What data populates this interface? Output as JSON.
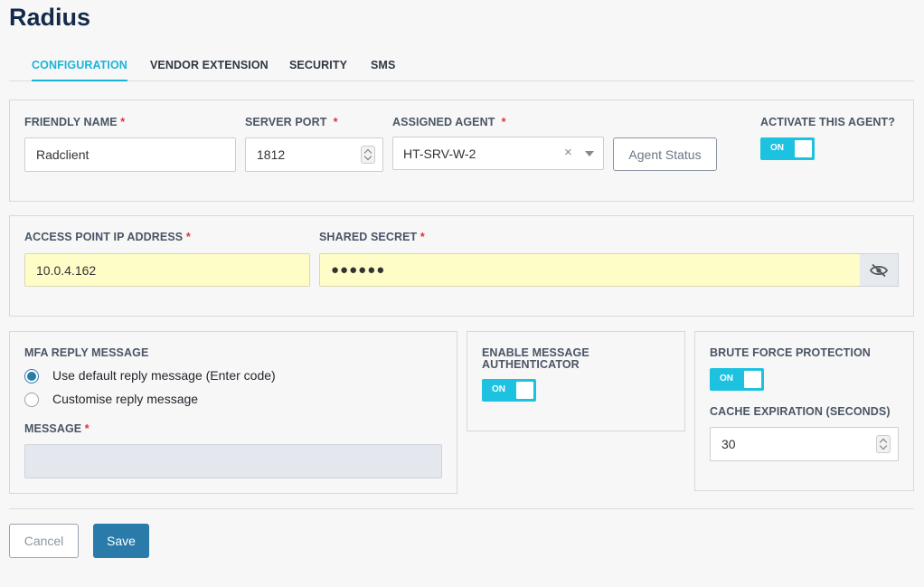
{
  "page": {
    "title": "Radius"
  },
  "tabs": [
    {
      "label": "CONFIGURATION"
    },
    {
      "label": "VENDOR EXTENSION"
    },
    {
      "label": "SECURITY"
    },
    {
      "label": "SMS"
    }
  ],
  "agent_section": {
    "friendly_name_label": "FRIENDLY NAME",
    "friendly_name_value": "Radclient",
    "server_port_label": "SERVER PORT",
    "server_port_value": "1812",
    "assigned_agent_label": "ASSIGNED AGENT",
    "assigned_agent_value": "HT-SRV-W-2",
    "agent_status_button": "Agent Status",
    "activate_label": "ACTIVATE THIS AGENT?",
    "activate_toggle": "ON"
  },
  "access_section": {
    "ip_label": "ACCESS POINT IP ADDRESS",
    "ip_value": "10.0.4.162",
    "secret_label": "SHARED SECRET",
    "secret_value": "●●●●●●"
  },
  "mfa_section": {
    "title": "MFA REPLY MESSAGE",
    "option_default": "Use default reply message (Enter code)",
    "option_custom": "Customise reply message",
    "message_label": "MESSAGE",
    "message_value": ""
  },
  "authenticator_section": {
    "title_line1": "ENABLE MESSAGE",
    "title_line2": "AUTHENTICATOR",
    "toggle": "ON"
  },
  "brute_force_section": {
    "title": "BRUTE FORCE PROTECTION",
    "toggle": "ON",
    "cache_label": "CACHE EXPIRATION (SECONDS)",
    "cache_value": "30"
  },
  "required_marker": "*",
  "clear_glyph": "×",
  "footer": {
    "cancel": "Cancel",
    "save": "Save"
  },
  "colors": {
    "accent": "#19b5d8",
    "toggle": "#1cc2e0",
    "primary": "#2a7aaa",
    "highlight": "#fefdc7",
    "required": "#d9343f"
  }
}
